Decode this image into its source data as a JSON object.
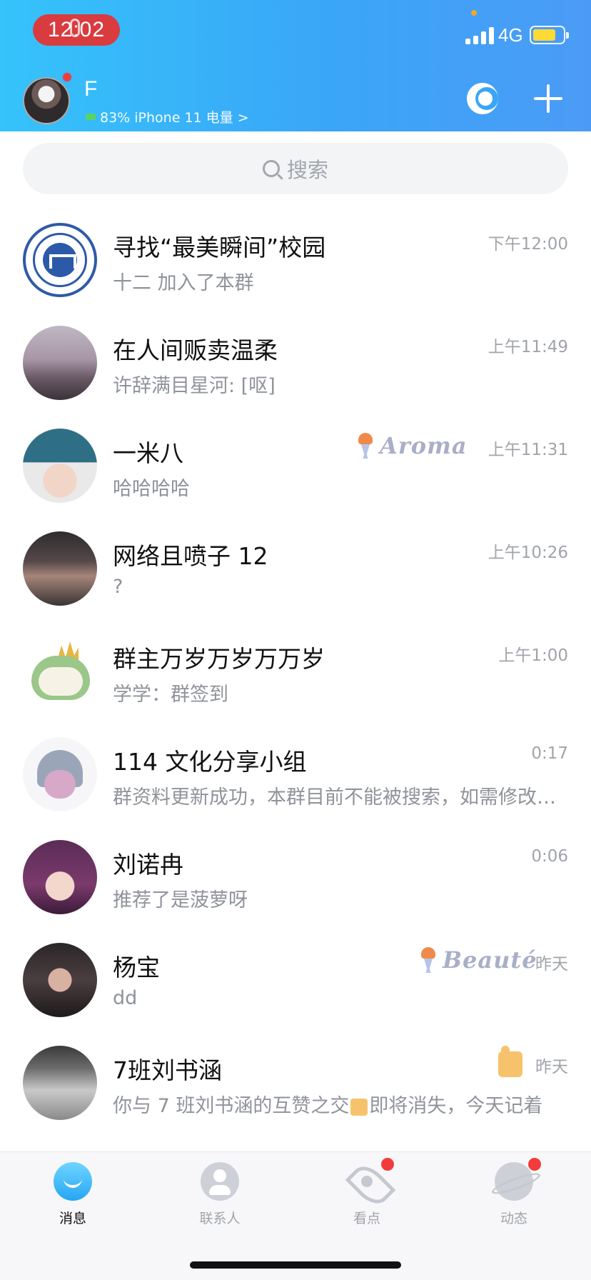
{
  "status_bar": {
    "time": "12:02",
    "network": "4G",
    "battery_level": 0.78,
    "icons": [
      "microphone-icon",
      "signal-icon",
      "battery-icon"
    ]
  },
  "header": {
    "profile_name": "F",
    "device_status": "83% iPhone 11 电量 >",
    "actions": [
      {
        "icon": "night-mode-icon"
      },
      {
        "icon": "plus-icon"
      }
    ]
  },
  "search": {
    "placeholder": "搜索"
  },
  "conversations": [
    {
      "title": "寻找“最美瞬间”校园",
      "preview": "十二 加入了本群",
      "time": "下午12:00"
    },
    {
      "title": "在人间贩卖温柔",
      "preview": "许辞满目星河: [呕]",
      "time": "上午11:49"
    },
    {
      "title": "一米八",
      "preview": "哈哈哈哈",
      "time": "上午11:31",
      "badge": "Aroma"
    },
    {
      "title": "网络且喷子 12",
      "preview": "?",
      "time": "上午10:26"
    },
    {
      "title": "群主万岁万岁万万岁",
      "preview": "学学：群签到",
      "time": "上午1:00"
    },
    {
      "title": "114 文化分享小组",
      "preview": "群资料更新成功，本群目前不能被搜索，如需修改，请设置",
      "time": "0:17"
    },
    {
      "title": "刘诺冉",
      "preview": "推荐了是菠萝呀",
      "time": "0:06"
    },
    {
      "title": "杨宝",
      "preview": "dd",
      "time": "昨天",
      "badge": "Beauté"
    },
    {
      "title": "7班刘书涵",
      "preview_before": "你与 7 班刘书涵的互赞之交",
      "preview_after": "即将消失，今天记着",
      "time": "昨天",
      "badge_icon": "thumbs-up-icon"
    }
  ],
  "tabs": [
    {
      "label": "消息",
      "icon": "message-icon",
      "active": true
    },
    {
      "label": "联系人",
      "icon": "contacts-icon",
      "active": false
    },
    {
      "label": "看点",
      "icon": "eye-icon",
      "active": false,
      "dot": true
    },
    {
      "label": "动态",
      "icon": "planet-icon",
      "active": false,
      "dot": true
    }
  ],
  "colors": {
    "header_start": "#35c3fb",
    "header_end": "#4b9bf5",
    "time_pill": "#d93b3f",
    "unread_dot": "#f23c3c",
    "secondary_text": "#8f939a"
  }
}
